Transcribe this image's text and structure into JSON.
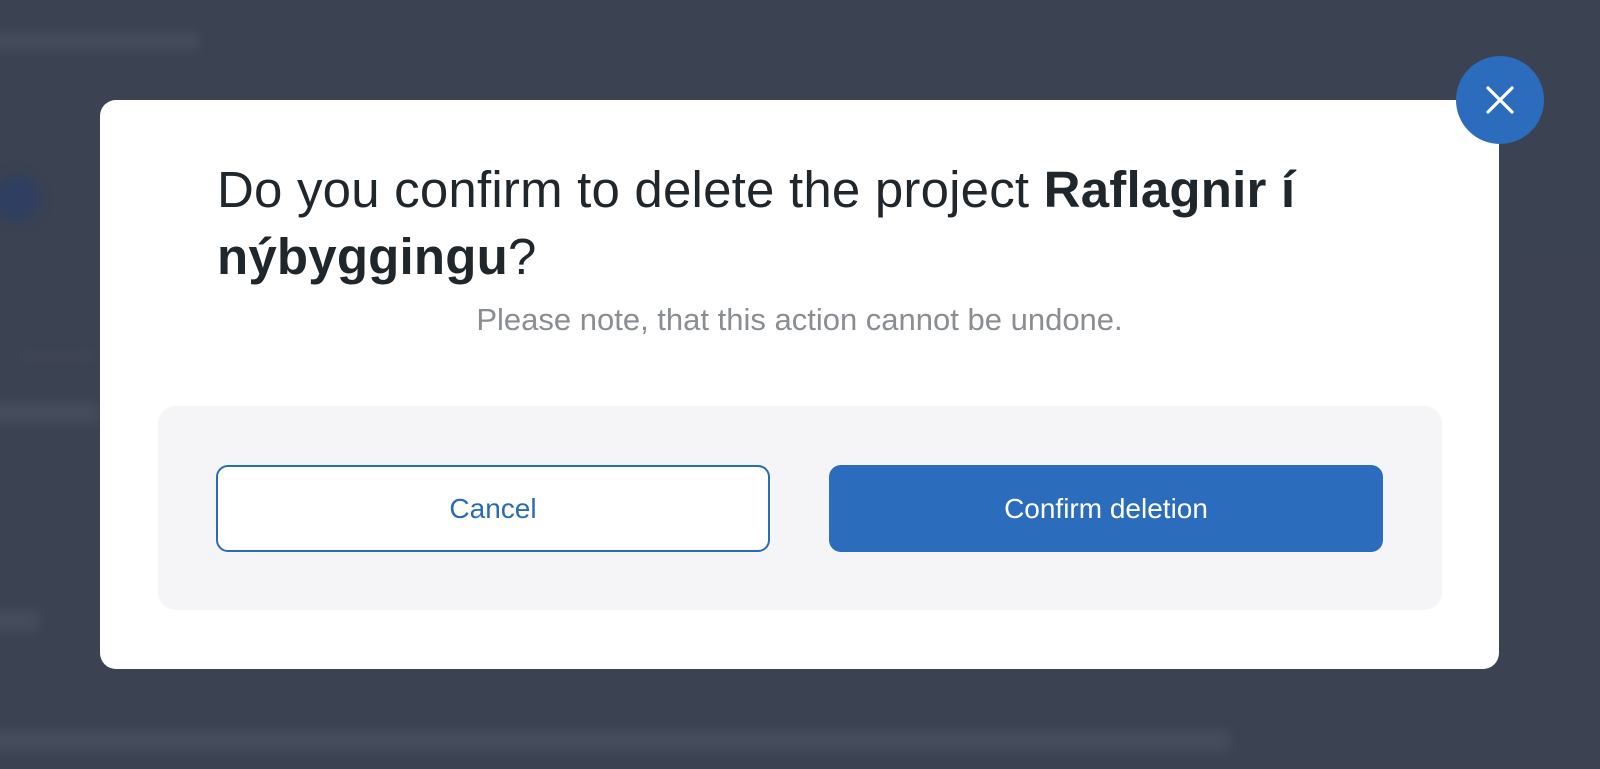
{
  "dialog": {
    "title_prefix": "Do you confirm to delete the project ",
    "project_name": "Raflagnir í nýbyggingu",
    "title_suffix": "?",
    "note": "Please note, that this action cannot be undone.",
    "cancel_label": "Cancel",
    "confirm_label": "Confirm deletion",
    "close_icon": "close-icon"
  },
  "colors": {
    "accent": "#2b6cbd",
    "backdrop": "#414757",
    "panel": "#ffffff",
    "actions_bg": "#f5f5f8",
    "note_text": "#8a8d92",
    "title_text": "#1f262c"
  }
}
